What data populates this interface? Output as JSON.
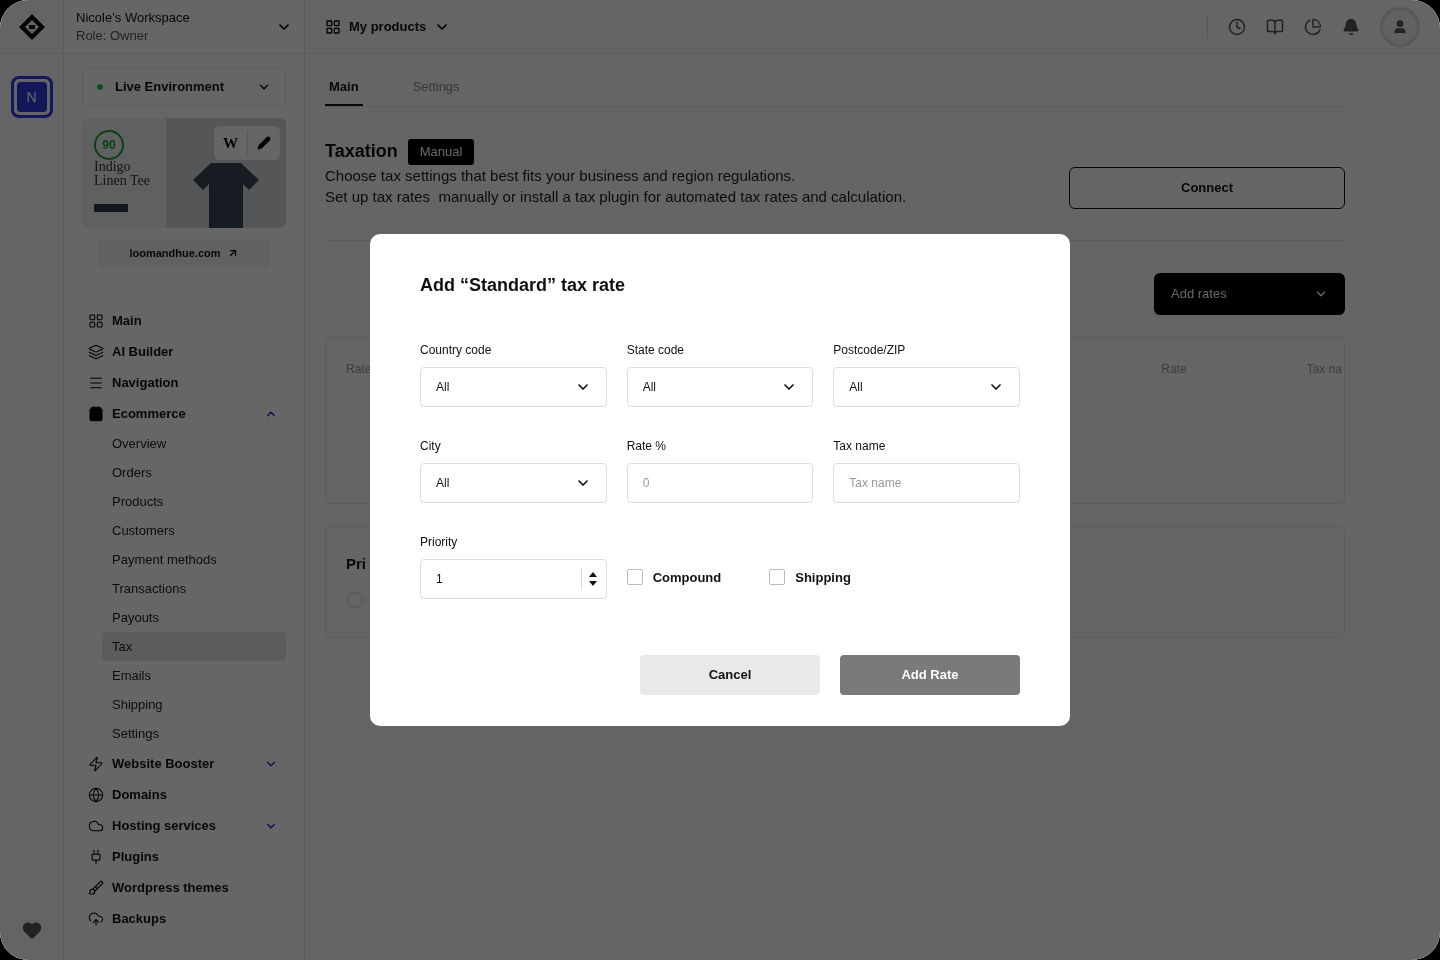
{
  "workspace": {
    "name": "Nicole’s Workspace",
    "role": "Role: Owner"
  },
  "rail": {
    "avatar_letter": "N",
    "selected": true
  },
  "environment": {
    "label": "Live Environment"
  },
  "preview": {
    "w": "W",
    "score": "90",
    "title": "Indigo\nLinen Tee",
    "domain": "loomandhue.com"
  },
  "nav": [
    {
      "label": "Main"
    },
    {
      "label": "AI Builder"
    },
    {
      "label": "Navigation"
    },
    {
      "label": "Ecommerce",
      "expanded": true,
      "children": [
        {
          "label": "Overview",
          "selected": false
        },
        {
          "label": "Orders",
          "selected": false
        },
        {
          "label": "Products",
          "selected": false
        },
        {
          "label": "Customers",
          "selected": false
        },
        {
          "label": "Payment methods",
          "selected": false
        },
        {
          "label": "Transactions",
          "selected": false
        },
        {
          "label": "Payouts",
          "selected": false
        },
        {
          "label": "Tax",
          "selected": true
        },
        {
          "label": "Emails",
          "selected": false
        },
        {
          "label": "Shipping",
          "selected": false
        },
        {
          "label": "Settings",
          "selected": false
        }
      ]
    },
    {
      "label": "Website Booster",
      "expanded": false
    },
    {
      "label": "Domains"
    },
    {
      "label": "Hosting services",
      "expanded": false
    },
    {
      "label": "Plugins"
    },
    {
      "label": "Wordpress themes"
    },
    {
      "label": "Backups"
    }
  ],
  "topbar": {
    "products": "My products"
  },
  "tabs": [
    {
      "label": "Main",
      "selected": true
    },
    {
      "label": "Settings",
      "selected": false
    }
  ],
  "taxation": {
    "title": "Taxation",
    "badge": "Manual",
    "lines": [
      "Choose tax settings that best fits your business and region regulations.",
      "Set up tax rates  manually or install a tax plugin for automated tax rates and calculation."
    ],
    "connect": "Connect",
    "add_rates": "Add rates"
  },
  "table": {
    "columns": [
      "Rate",
      "Rate",
      "Tax na"
    ]
  },
  "section_2": {
    "title": "Pri",
    "radio_selected": false
  },
  "modal": {
    "title": "Add “Standard” tax rate",
    "fields": [
      {
        "kind": "select",
        "label": "Country code",
        "value": "All"
      },
      {
        "kind": "select",
        "label": "State code",
        "value": "All"
      },
      {
        "kind": "select",
        "label": "Postcode/ZIP",
        "value": "All"
      },
      {
        "kind": "select",
        "label": "City",
        "value": "All"
      },
      {
        "kind": "text",
        "label": "Rate %",
        "placeholder": "0"
      },
      {
        "kind": "text",
        "label": "Tax name",
        "placeholder": "Tax name"
      }
    ],
    "priority": {
      "label": "Priority",
      "value": "1"
    },
    "checkboxes": [
      {
        "label": "Compound",
        "checked": false
      },
      {
        "label": "Shipping",
        "checked": false
      }
    ],
    "buttons": [
      {
        "label": "Cancel",
        "kind": "secondary"
      },
      {
        "label": "Add Rate",
        "kind": "primary"
      }
    ]
  }
}
